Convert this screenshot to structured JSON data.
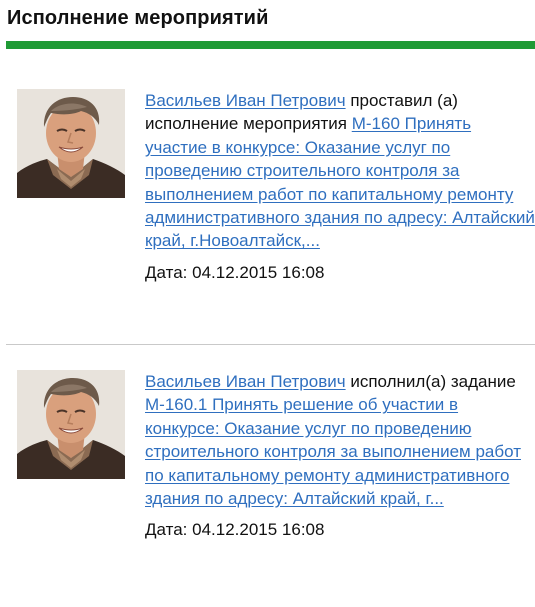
{
  "header": {
    "title": "Исполнение мероприятий"
  },
  "colors": {
    "accent_bar": "#1f9a35",
    "link": "#2f6fbf"
  },
  "activities": [
    {
      "avatar_icon": "user-photo",
      "user_name": "Васильев Иван Петрович",
      "action_text": " проставил (а) исполнение мероприятия ",
      "item_link": "М-160 Принять участие в конкурсе: Оказание услуг по проведению строительного контроля за выполнением работ по капитальному ремонту административного здания по адресу: Алтайский край, г.Новоалтайск,...",
      "date_label": "Дата:",
      "date_value": "04.12.2015 16:08"
    },
    {
      "avatar_icon": "user-photo",
      "user_name": "Васильев Иван Петрович",
      "action_text": " исполнил(а) задание ",
      "item_link": "М-160.1 Принять решение об участии в конкурсе: Оказание услуг по проведению строительного контроля за выполнением работ по капитальному ремонту административного здания по адресу: Алтайский край, г...",
      "date_label": "Дата:",
      "date_value": "04.12.2015 16:08"
    }
  ]
}
